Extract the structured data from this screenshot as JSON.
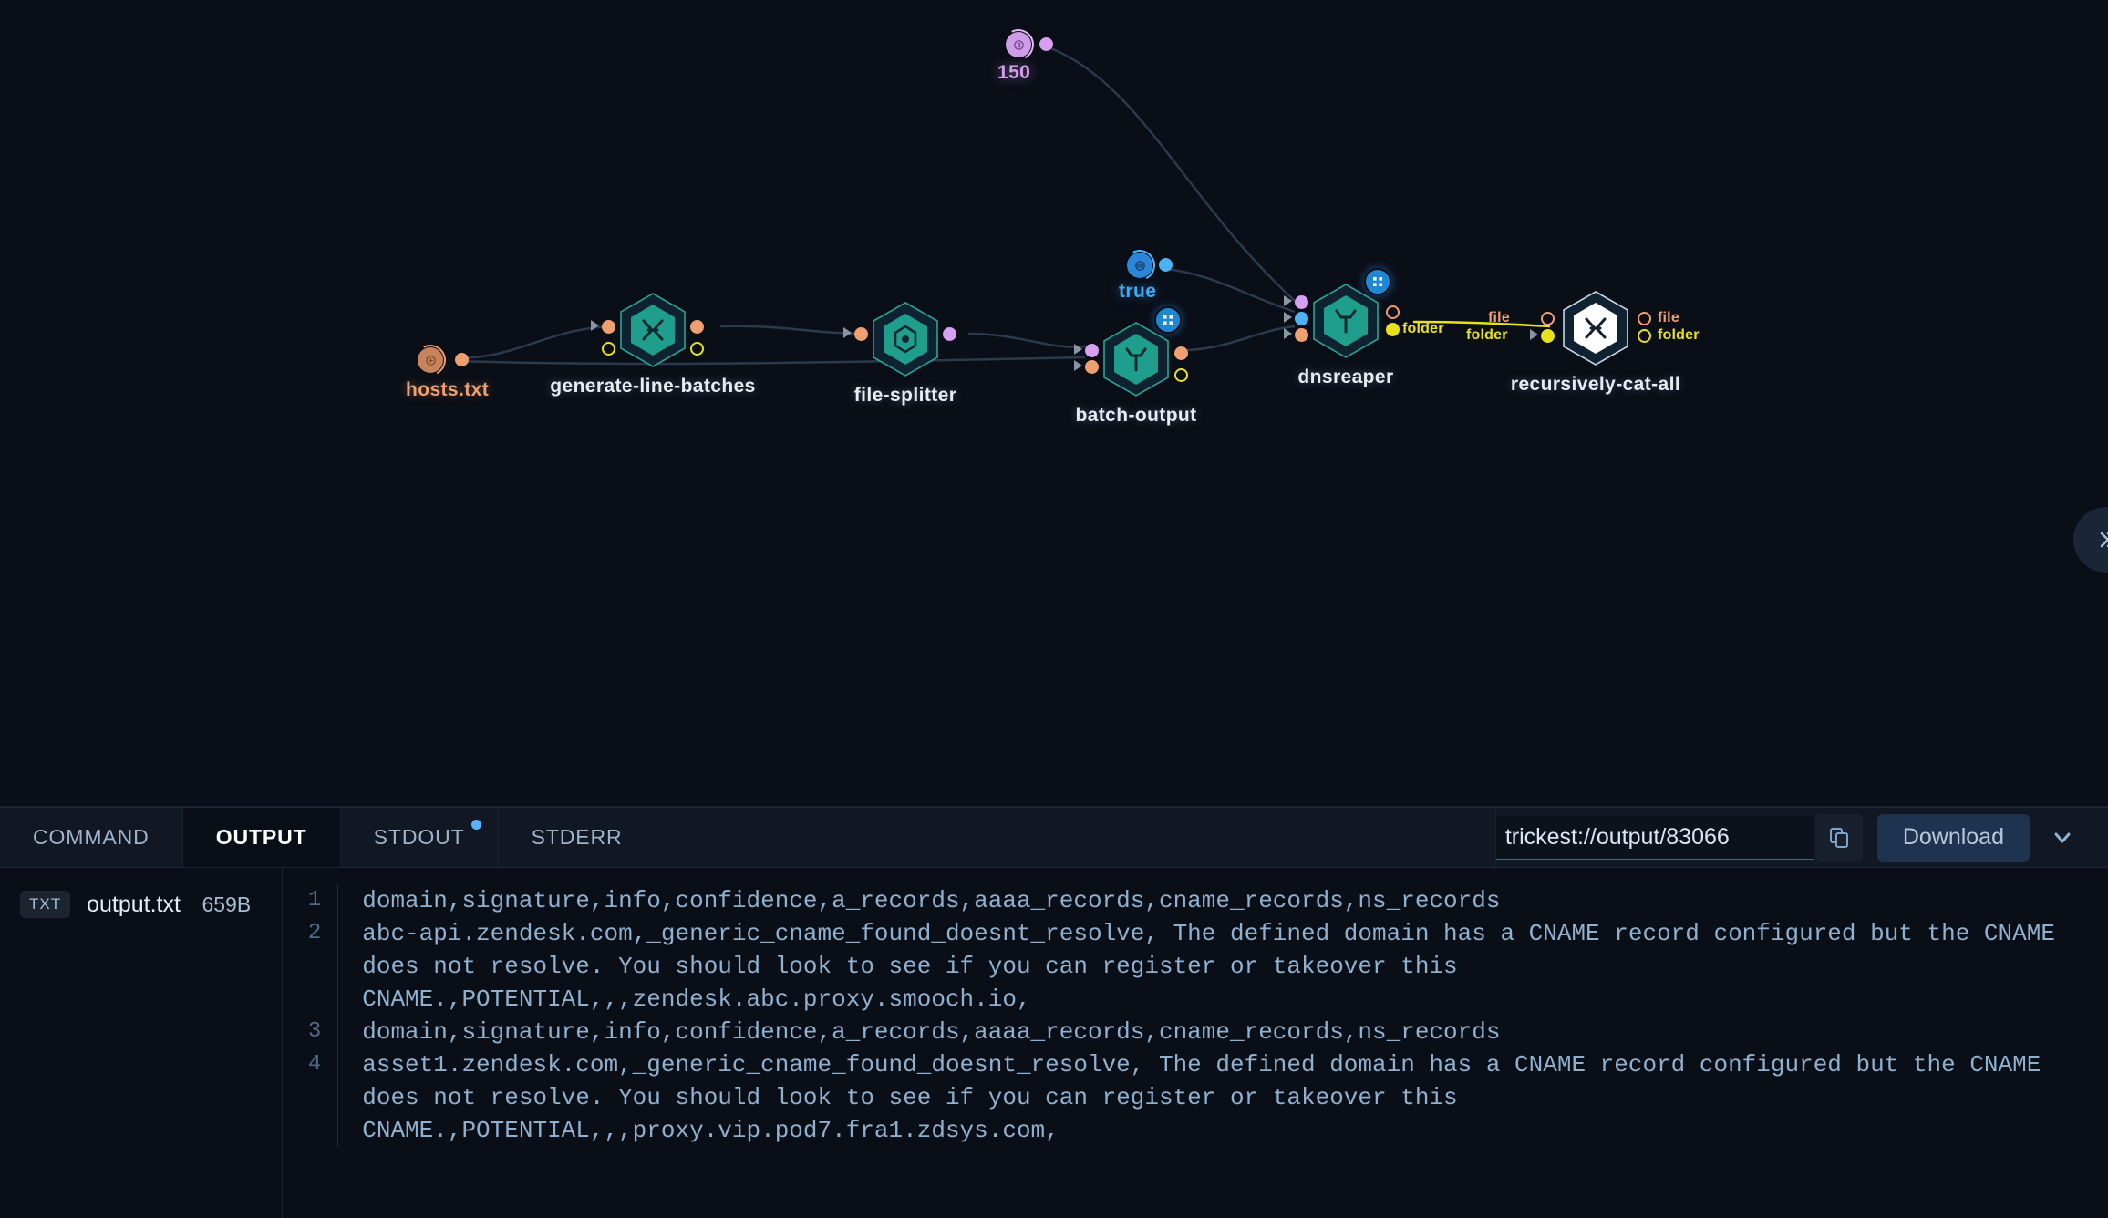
{
  "canvas": {
    "nodes": [
      {
        "id": "hosts-file",
        "label": "hosts.txt",
        "type": "file-input",
        "color": "#f0a070"
      },
      {
        "id": "generate-line-batches",
        "label": "generate-line-batches",
        "type": "tool",
        "color": "#1f9e8e"
      },
      {
        "id": "file-splitter",
        "label": "file-splitter",
        "type": "tool",
        "color": "#1f9e8e"
      },
      {
        "id": "batch-output",
        "label": "batch-output",
        "type": "tool",
        "color": "#1f9e8e"
      },
      {
        "id": "dnsreaper",
        "label": "dnsreaper",
        "type": "tool",
        "color": "#1f9e8e"
      },
      {
        "id": "recursively-cat-all",
        "label": "recursively-cat-all",
        "type": "tool",
        "color": "#ffffff"
      },
      {
        "id": "batch-size",
        "label": "150",
        "type": "number-input",
        "color": "#d79ff0"
      },
      {
        "id": "boolean-true",
        "label": "true",
        "type": "boolean-input",
        "color": "#42aaf5"
      }
    ],
    "port_labels": {
      "dnsreaper_out_folder": "folder",
      "cat_in_folder": "folder",
      "cat_in_file": "file",
      "cat_out_file": "file",
      "cat_out_folder": "folder"
    }
  },
  "panel": {
    "tabs": [
      {
        "label": "COMMAND",
        "active": false,
        "dot": false
      },
      {
        "label": "OUTPUT",
        "active": true,
        "dot": false
      },
      {
        "label": "STDOUT",
        "active": false,
        "dot": true
      },
      {
        "label": "STDERR",
        "active": false,
        "dot": false
      }
    ],
    "url_value": "trickest://output/83066",
    "url_placeholder": "trickest://output/...",
    "download_label": "Download",
    "files": [
      {
        "badge": "TXT",
        "name": "output.txt",
        "size": "659B"
      }
    ],
    "viewer": {
      "lines": [
        {
          "n": "1",
          "text": "domain,signature,info,confidence,a_records,aaaa_records,cname_records,ns_records"
        },
        {
          "n": "2",
          "text": "abc-api.zendesk.com,_generic_cname_found_doesnt_resolve, The defined domain has a CNAME record configured but the CNAME does not resolve. You should look to see if you can register or takeover this CNAME.,POTENTIAL,,,zendesk.abc.proxy.smooch.io,"
        },
        {
          "n": "3",
          "text": "domain,signature,info,confidence,a_records,aaaa_records,cname_records,ns_records"
        },
        {
          "n": "4",
          "text": "asset1.zendesk.com,_generic_cname_found_doesnt_resolve, The defined domain has a CNAME record configured but the CNAME does not resolve. You should look to see if you can register or takeover this CNAME.,POTENTIAL,,,proxy.vip.pod7.fra1.zdsys.com,"
        }
      ]
    }
  }
}
